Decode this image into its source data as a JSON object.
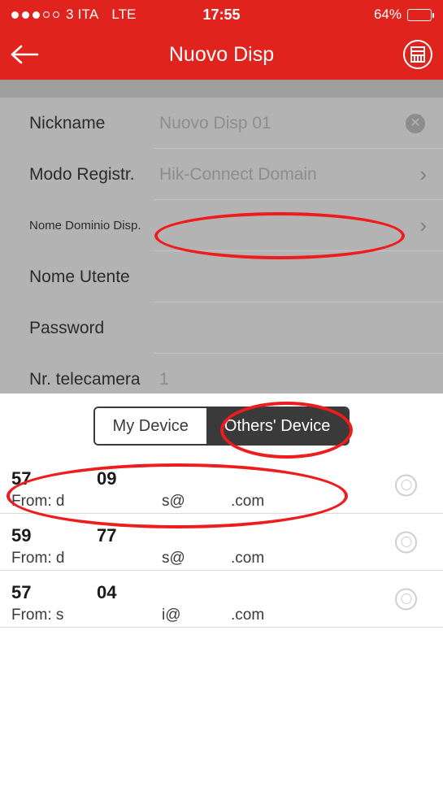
{
  "status_bar": {
    "carrier": "3 ITA",
    "network": "LTE",
    "time": "17:55",
    "battery_percent": "64%",
    "signal_filled_dots": 3,
    "signal_hollow_dots": 2
  },
  "nav": {
    "title": "Nuovo Disp",
    "back_icon": "back-arrow-icon",
    "right_icon": "scan-qr-icon"
  },
  "form": {
    "rows": [
      {
        "label": "Nickname",
        "value": "Nuovo Disp 01",
        "accessory": "clear",
        "label_size": "normal"
      },
      {
        "label": "Modo Registr.",
        "value": "Hik-Connect Domain",
        "accessory": "chevron",
        "label_size": "normal"
      },
      {
        "label": "Nome Dominio Disp.",
        "value": "",
        "accessory": "chevron",
        "label_size": "small"
      },
      {
        "label": "Nome Utente",
        "value": "",
        "accessory": "none",
        "label_size": "normal"
      },
      {
        "label": "Password",
        "value": "",
        "accessory": "none",
        "label_size": "normal"
      },
      {
        "label": "Nr. telecamera",
        "value": "1",
        "accessory": "none",
        "label_size": "normal"
      }
    ]
  },
  "sheet": {
    "segments": [
      {
        "label": "My Device",
        "active": false
      },
      {
        "label": "Others' Device",
        "active": true
      }
    ],
    "devices": [
      {
        "serial_a": "57",
        "serial_b": "09",
        "from_prefix": "From: d",
        "from_mid": "s@",
        "from_suffix": ".com",
        "selected": false
      },
      {
        "serial_a": "59",
        "serial_b": "77",
        "from_prefix": "From: d",
        "from_mid": "s@",
        "from_suffix": ".com",
        "selected": false
      },
      {
        "serial_a": "57",
        "serial_b": "04",
        "from_prefix": "From: s",
        "from_mid": "i@",
        "from_suffix": ".com",
        "selected": false
      }
    ]
  },
  "annotations": {
    "ellipse_domain": "red-ellipse-domain-field",
    "ellipse_segment": "red-ellipse-others-device-tab",
    "ellipse_device": "red-ellipse-first-device"
  },
  "colors": {
    "brand_red": "#e1231e",
    "annotation_red": "#ee1c1c",
    "dim_overlay": "#b3b3b3",
    "segment_dark": "#3a3a3a"
  }
}
